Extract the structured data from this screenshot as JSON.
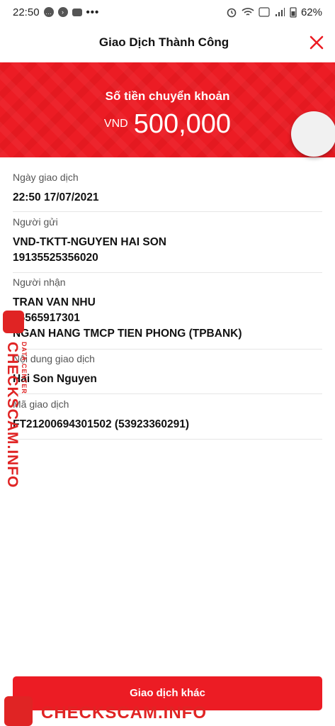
{
  "status_bar": {
    "time": "22:50",
    "battery": "62%"
  },
  "header": {
    "title": "Giao Dịch Thành Công"
  },
  "banner": {
    "label": "Số tiền chuyển khoản",
    "currency": "VND",
    "amount": "500,000"
  },
  "details": {
    "date": {
      "label": "Ngày giao dịch",
      "value": "22:50 17/07/2021"
    },
    "sender": {
      "label": "Người gửi",
      "name": "VND-TKTT-NGUYEN HAI SON",
      "account": "19135525356020"
    },
    "receiver": {
      "label": "Người nhận",
      "name": "TRAN VAN NHU",
      "account": "06565917301",
      "bank": "NGAN HANG TMCP TIEN PHONG (TPBANK)"
    },
    "content": {
      "label": "Nội dung giao dịch",
      "value": "Hai Son Nguyen"
    },
    "code": {
      "label": "Mã giao dịch",
      "value": "FT21200694301502 (53923360291)"
    }
  },
  "footer": {
    "button_label": "Giao dịch khác"
  },
  "watermark": {
    "brand": "CHECKSCAM.INFO",
    "sub": "DATA CENTER"
  },
  "colors": {
    "accent": "#ec1c24",
    "watermark": "#e02424"
  }
}
